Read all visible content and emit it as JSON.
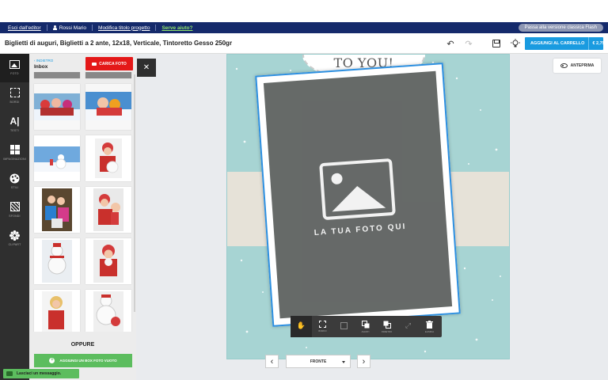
{
  "topnav": {
    "exit": "Esci dall'editor",
    "user": "Rossi Mario",
    "edit_title": "Modifica titolo progetto",
    "help": "Serve aiuto?",
    "flash": "Passa alla versione classica Flash"
  },
  "titlebar": {
    "title": "Biglietti di auguri, Biglietti a 2 ante, 12x18, Verticale, Tintoretto Gesso 250gr",
    "cart_label": "AGGIUNGI AL CARRELLO",
    "price": "€ 2,79"
  },
  "rail": {
    "items": [
      {
        "label": "FOTO",
        "icon": "photo-icon"
      },
      {
        "label": "BORDI",
        "icon": "border-icon"
      },
      {
        "label": "TESTI",
        "icon": "text-icon"
      },
      {
        "label": "IMPAGINAZIONI",
        "icon": "layout-icon"
      },
      {
        "label": "STILI",
        "icon": "palette-icon"
      },
      {
        "label": "SFONDI",
        "icon": "background-icon"
      },
      {
        "label": "CLIPART",
        "icon": "clipart-icon"
      }
    ]
  },
  "panel": {
    "back": "INDIETRO",
    "folder": "Inbox",
    "upload": "CARICA FOTO",
    "or": "OPPURE",
    "add_box": "AGGIUNGI UN BOX FOTO VUOTO"
  },
  "chat": {
    "label": "Lasciaci un messaggio."
  },
  "preview": {
    "label": "ANTEPRIMA"
  },
  "canvas": {
    "greeting": "TO YOU!",
    "photo_placeholder": "LA TUA FOTO QUI",
    "colors": {
      "card": "#a7d4d3",
      "stripe": "#e6e2d8",
      "frame_border": "#2c8fe0"
    }
  },
  "canvas_toolbar": {
    "items": [
      {
        "name": "move-icon",
        "label": ""
      },
      {
        "name": "border-icon",
        "label": "BORDO"
      },
      {
        "name": "replace-icon",
        "label": ""
      },
      {
        "name": "bring-forward-icon",
        "label": "AVANTI"
      },
      {
        "name": "send-back-icon",
        "label": "INDIETRO"
      },
      {
        "name": "resize-icon",
        "label": ""
      },
      {
        "name": "delete-icon",
        "label": "ELIMINA"
      }
    ]
  },
  "pager": {
    "current": "FRONTE"
  },
  "colors": {
    "topnav": "#152a6b",
    "cart": "#1a9be0",
    "upload": "#e41818",
    "add": "#5cbd5e"
  }
}
